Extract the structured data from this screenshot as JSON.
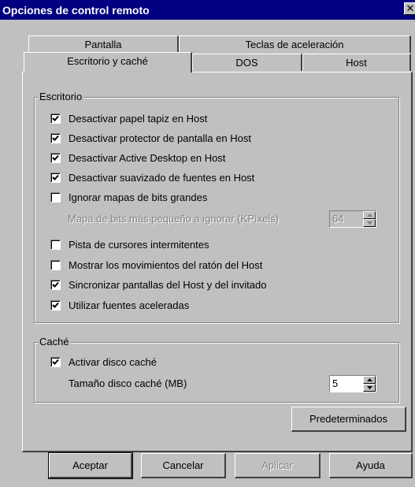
{
  "window": {
    "title": "Opciones de control remoto",
    "close_glyph": "✕"
  },
  "tabs": {
    "back_row": [
      "Pantalla",
      "Teclas de aceleración"
    ],
    "front_row": [
      "Escritorio y caché",
      "DOS",
      "Host"
    ],
    "active": "Escritorio y caché"
  },
  "escritorio": {
    "label": "Escritorio",
    "options": [
      {
        "label": "Desactivar papel tapiz en Host",
        "checked": true
      },
      {
        "label": "Desactivar protector de pantalla en Host",
        "checked": true
      },
      {
        "label": "Desactivar Active Desktop en Host",
        "checked": true
      },
      {
        "label": "Desactivar suavizado de fuentes en Host",
        "checked": true
      },
      {
        "label": "Ignorar mapas de bits grandes",
        "checked": false
      }
    ],
    "min_bitmap_label": "Mapa de bits más pequeño a ignorar (KPíxels)",
    "min_bitmap_value": "64",
    "options2": [
      {
        "label": "Pista de cursores intermitentes",
        "checked": false
      },
      {
        "label": "Mostrar los movimientos del ratón del Host",
        "checked": false
      },
      {
        "label": "Sincronizar pantallas del Host y del invitado",
        "checked": true
      },
      {
        "label": "Utilizar fuentes aceleradas",
        "checked": true
      }
    ]
  },
  "cache": {
    "label": "Caché",
    "enable_label": "Activar disco caché",
    "enable_checked": true,
    "size_label": "Tamaño disco caché (MB)",
    "size_value": "5"
  },
  "buttons": {
    "defaults": "Predeterminados",
    "ok": "Aceptar",
    "cancel": "Cancelar",
    "apply": "Aplicar",
    "help": "Ayuda"
  },
  "colors": {
    "titlebar": "#000080",
    "face": "#c0c0c0",
    "disabled_text": "#808080"
  },
  "icons": {
    "close": "close-icon",
    "check": "check-icon",
    "spin_up": "arrow-up-icon",
    "spin_down": "arrow-down-icon"
  }
}
